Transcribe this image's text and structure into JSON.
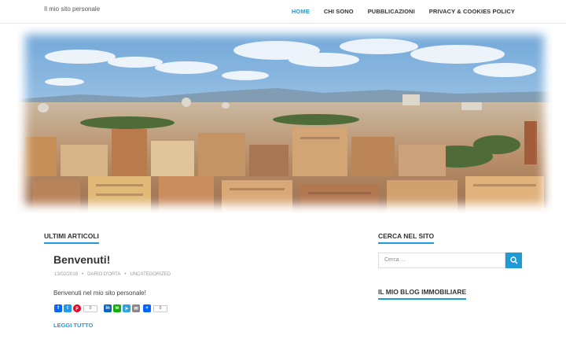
{
  "header": {
    "site_description": "Il mio sito personale",
    "nav": [
      {
        "label": "HOME",
        "active": true
      },
      {
        "label": "CHI SONO",
        "active": false
      },
      {
        "label": "PUBBLICAZIONI",
        "active": false
      },
      {
        "label": "PRIVACY & COOKIES POLICY",
        "active": false
      }
    ]
  },
  "colors": {
    "accent": "#1e9bd7",
    "text": "#333333",
    "meta": "#999999",
    "border": "#e6e6e6"
  },
  "main": {
    "section_title": "ULTIMI ARTICOLI",
    "post": {
      "title": "Benvenuti!",
      "date": "13/02/2018",
      "author": "DARIO D'ORTA",
      "category": "UNCATEGORIZED",
      "excerpt": "Benvenuti nel mio sito personale!",
      "read_more": "LEGGI TUTTO",
      "share": {
        "icons": [
          "facebook-icon",
          "twitter-icon",
          "pinterest-icon",
          "linkedin-icon",
          "whatsapp-icon",
          "telegram-icon",
          "email-icon",
          "share-icon"
        ],
        "pinterest_count": "0",
        "total_count": "0"
      }
    }
  },
  "sidebar": {
    "search_title": "CERCA NEL SITO",
    "search_placeholder": "Cerca …",
    "blog_title": "IL MIO BLOG IMMOBILIARE"
  }
}
